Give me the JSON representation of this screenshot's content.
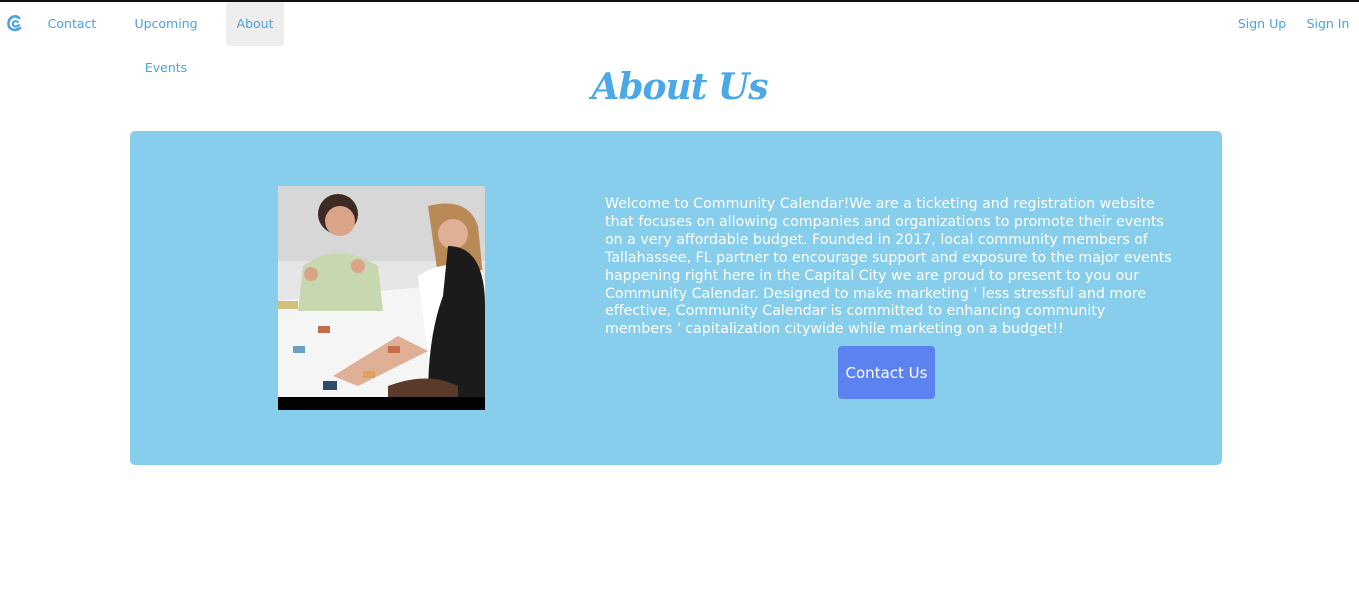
{
  "navbar": {
    "logo_icon": "community-calendar-logo-icon",
    "links": [
      {
        "label": "Contact"
      },
      {
        "label": "Upcoming Events"
      },
      {
        "label": "About"
      }
    ],
    "sign_up": "Sign Up",
    "sign_in": "Sign In"
  },
  "page": {
    "title": "About Us"
  },
  "about": {
    "image_icon": "team-meeting-photo",
    "text": "Welcome to Community Calendar!We are a ticketing and registration website that focuses on allowing companies and organizations to promote their events on a very affordable budget. Founded in 2017, local community members of Tallahassee, FL partner to encourage support and exposure to the major events happening right here in the Capital City we are proud to present to you our Community Calendar. Designed to make marketing ' less stressful and more effective, Community Calendar is committed to enhancing community members ' capitalization citywide while marketing on a budget!!",
    "button_label": "Contact Us"
  },
  "colors": {
    "accent": "#4aa3df",
    "panel": "#87cdec",
    "button": "#5b82ef"
  }
}
